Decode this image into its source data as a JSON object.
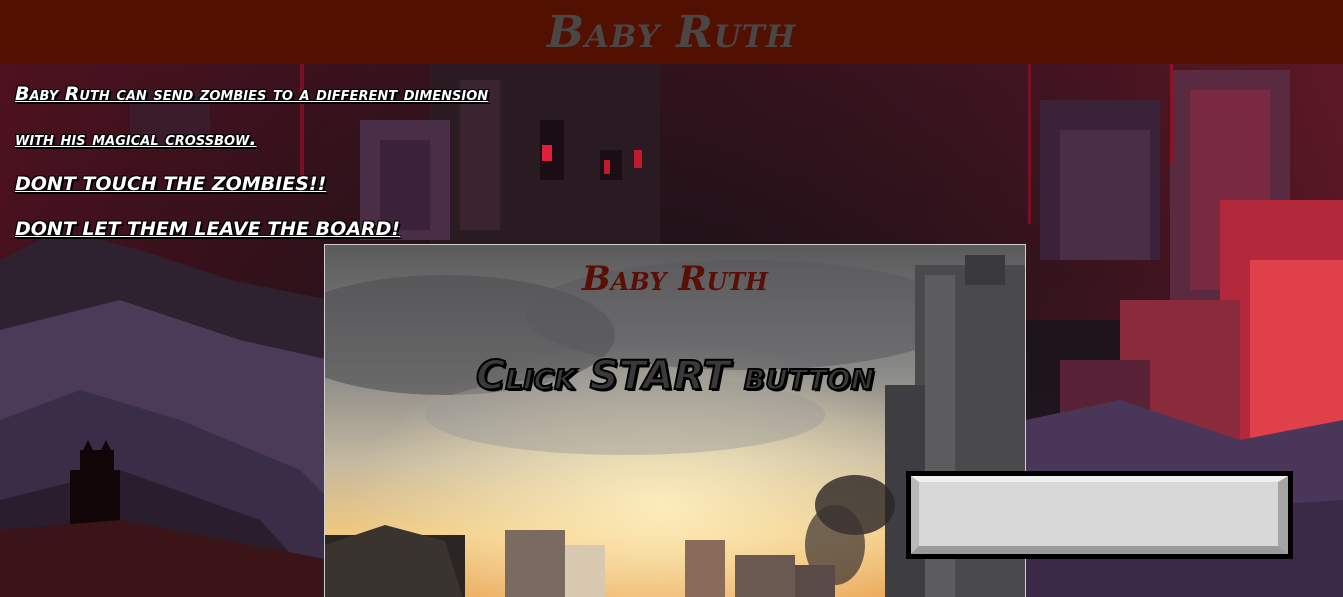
{
  "header": {
    "title": "Baby Ruth"
  },
  "instructions": {
    "lines": [
      "Baby Ruth can send zombies to a different dimension",
      "with his magical crossbow.",
      "DONT TOUCH THE ZOMBIES!!",
      "DONT LET THEM LEAVE THE BOARD!"
    ]
  },
  "game_board": {
    "title": "Baby Ruth",
    "prompt": "Click START button"
  },
  "start_button": {
    "label": ""
  },
  "colors": {
    "header_bg": "#521000",
    "header_text": "#4a4646",
    "board_title": "#5a0f04",
    "instruction_text": "#ffffff"
  }
}
